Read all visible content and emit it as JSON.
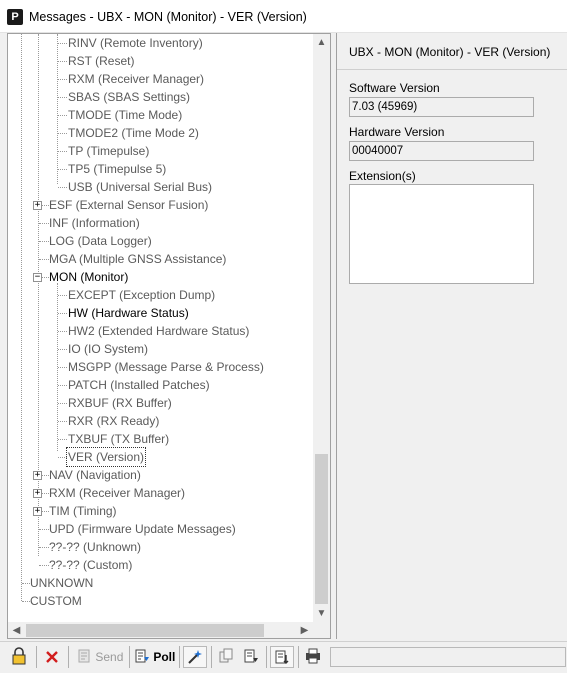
{
  "window": {
    "title": "Messages - UBX - MON (Monitor) - VER (Version)",
    "app_icon_letter": "P"
  },
  "tree": {
    "cfg_children": [
      "RINV (Remote Inventory)",
      "RST (Reset)",
      "RXM (Receiver Manager)",
      "SBAS (SBAS Settings)",
      "TMODE (Time Mode)",
      "TMODE2 (Time Mode 2)",
      "TP (Timepulse)",
      "TP5 (Timepulse 5)",
      "USB (Universal Serial Bus)"
    ],
    "groups_before": [
      "ESF (External Sensor Fusion)",
      "INF (Information)",
      "LOG (Data Logger)",
      "MGA (Multiple GNSS Assistance)"
    ],
    "mon": "MON (Monitor)",
    "mon_children": [
      "EXCEPT (Exception Dump)",
      "HW (Hardware Status)",
      "HW2 (Extended Hardware Status)",
      "IO (IO System)",
      "MSGPP (Message Parse & Process)",
      "PATCH (Installed Patches)",
      "RXBUF (RX Buffer)",
      "RXR (RX Ready)",
      "TXBUF (TX Buffer)",
      "VER (Version)"
    ],
    "groups_after": [
      "NAV (Navigation)",
      "RXM (Receiver Manager)",
      "TIM (Timing)",
      "UPD (Firmware Update Messages)",
      "??-?? (Unknown)",
      "??-?? (Custom)"
    ],
    "root_items": [
      "UNKNOWN",
      "CUSTOM"
    ],
    "expander_plus": "+",
    "expander_minus": "−"
  },
  "panel": {
    "title": "UBX - MON (Monitor) - VER (Version)",
    "software_label": "Software Version",
    "software_value": "7.03 (45969)",
    "hardware_label": "Hardware Version",
    "hardware_value": "00040007",
    "extensions_label": "Extension(s)"
  },
  "toolbar": {
    "send_label": "Send",
    "poll_label": "Poll"
  },
  "scroll": {
    "up": "▲",
    "down": "▼",
    "left": "◀",
    "right": "▶"
  }
}
